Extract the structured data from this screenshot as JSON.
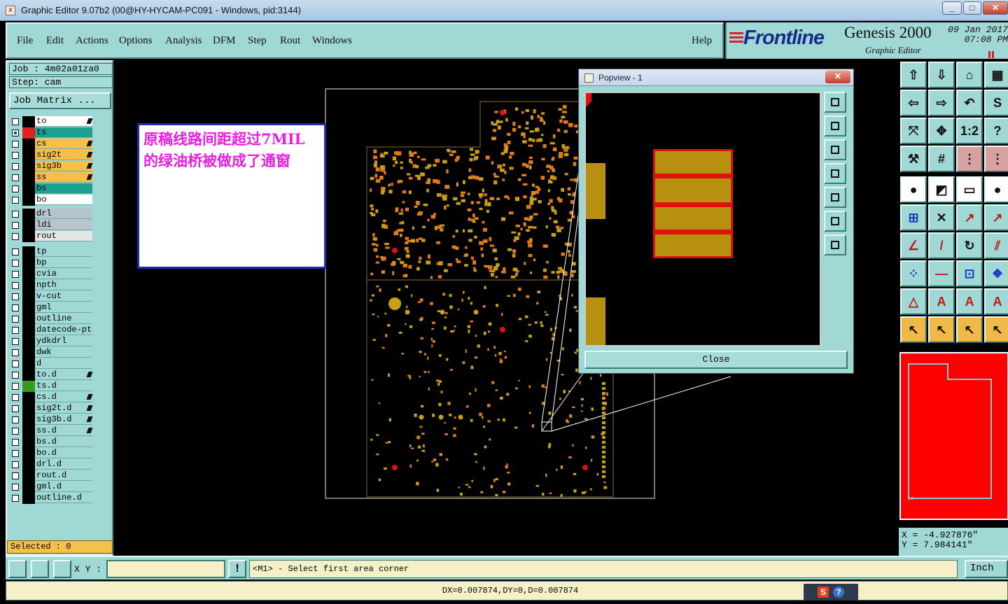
{
  "window": {
    "title": "Graphic Editor 9.07b2 (00@HY-HYCAM-PC091 - Windows, pid:3144)",
    "minimize": "_",
    "maximize": "□",
    "close": "✕"
  },
  "menu": {
    "items": [
      "File",
      "Edit",
      "Actions",
      "Options",
      "Analysis",
      "DFM",
      "Step",
      "Rout",
      "Windows"
    ],
    "help": "Help"
  },
  "brand": {
    "logo": "Frontline",
    "product": "Genesis 2000",
    "subtitle": "Graphic Editor",
    "date": "09 Jan 2017",
    "time": "07:08 PM",
    "accent": "#d2222a"
  },
  "left": {
    "job": "Job : 4m02a01za0",
    "step": "Step: cam",
    "job_matrix": "Job Matrix ...",
    "layers_board": [
      {
        "name": "to",
        "color": "#ffffff",
        "swatch": "#000000",
        "pen": true
      },
      {
        "name": "ts",
        "color": "#1ea090",
        "swatch": "#e02020",
        "pen": false,
        "active": true
      },
      {
        "name": "cs",
        "color": "#f4c04a",
        "swatch": "#000000",
        "pen": true
      },
      {
        "name": "sig2t",
        "color": "#f4c04a",
        "swatch": "#000000",
        "pen": true
      },
      {
        "name": "sig3b",
        "color": "#f4c04a",
        "swatch": "#000000",
        "pen": true
      },
      {
        "name": "ss",
        "color": "#f4c04a",
        "swatch": "#000000",
        "pen": true
      },
      {
        "name": "bs",
        "color": "#1ea090",
        "swatch": "#000000",
        "pen": false
      },
      {
        "name": "bo",
        "color": "#ffffff",
        "swatch": "#000000",
        "pen": false
      }
    ],
    "layers_drill": [
      {
        "name": "drl",
        "color": "#b8c4cc"
      },
      {
        "name": "ldi",
        "color": "#b8c4cc"
      },
      {
        "name": "rout",
        "color": "#e6e6e6"
      }
    ],
    "layers_misc": [
      {
        "name": "tp",
        "pen": false
      },
      {
        "name": "bp",
        "pen": false
      },
      {
        "name": "cvia",
        "pen": false
      },
      {
        "name": "npth",
        "pen": false
      },
      {
        "name": "v-cut",
        "pen": false
      },
      {
        "name": "gml",
        "pen": false
      },
      {
        "name": "outline",
        "pen": false
      },
      {
        "name": "datecode-pte",
        "pen": false
      },
      {
        "name": "ydkdrl",
        "pen": false
      },
      {
        "name": "dwk",
        "pen": false
      },
      {
        "name": "d",
        "pen": false
      },
      {
        "name": "to.d",
        "pen": true
      },
      {
        "name": "ts.d",
        "pen": false,
        "swatch": "#3a9a20"
      },
      {
        "name": "cs.d",
        "pen": true
      },
      {
        "name": "sig2t.d",
        "pen": true
      },
      {
        "name": "sig3b.d",
        "pen": true
      },
      {
        "name": "ss.d",
        "pen": true
      },
      {
        "name": "bs.d",
        "pen": false
      },
      {
        "name": "bo.d",
        "pen": false
      },
      {
        "name": "drl.d",
        "pen": false
      },
      {
        "name": "rout.d",
        "pen": false
      },
      {
        "name": "gml.d",
        "pen": false
      },
      {
        "name": "outline.d",
        "pen": false
      }
    ],
    "selected": "Selected : 0"
  },
  "annotation": {
    "line1": "原稿线路间距超过7MIL",
    "line2": "的绿油桥被做成了通窗",
    "color": "#e81ee0"
  },
  "popview": {
    "title": "Popview - 1",
    "close_x": "✕",
    "close_button": "Close"
  },
  "right": {
    "x": "X = -4.927876\"",
    "y": "Y = 7.984141\""
  },
  "bottom": {
    "xy_label": "X Y :",
    "xy_value": "",
    "prompt": "<M1> - Select first area corner",
    "unit": "Inch",
    "status": "DX=0.007874,DY=0,D=0.007874"
  }
}
